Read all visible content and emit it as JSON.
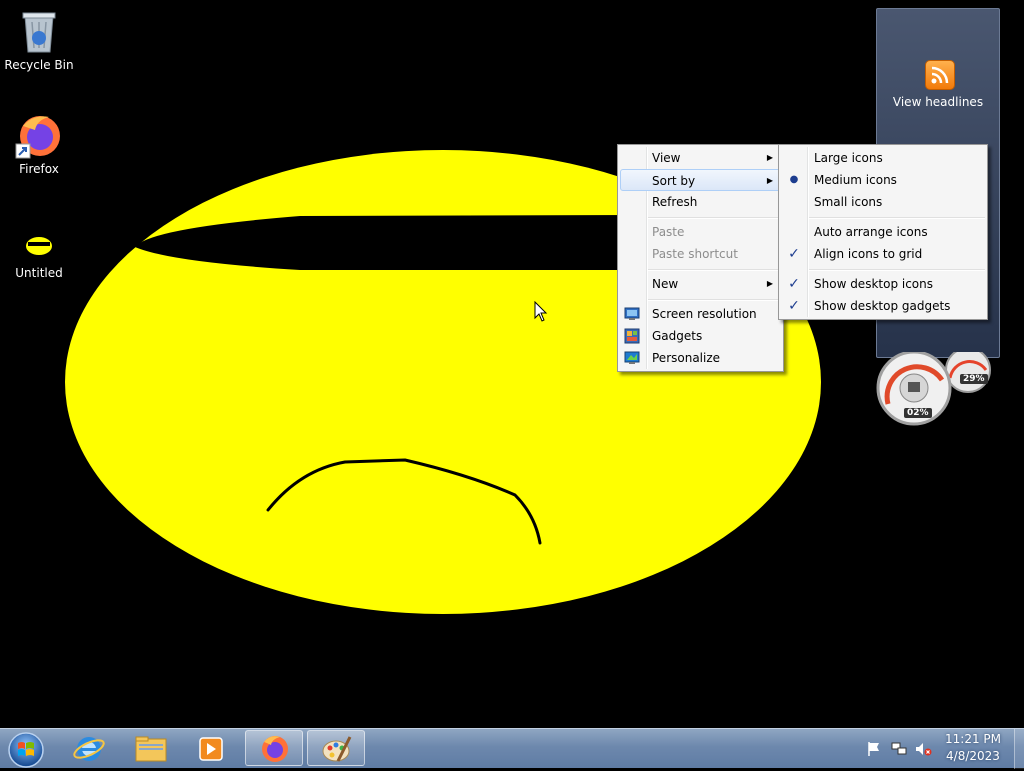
{
  "desktop": {
    "icons": [
      {
        "label": "Recycle Bin",
        "icon": "recycle-bin-icon"
      },
      {
        "label": "Firefox",
        "icon": "firefox-icon"
      },
      {
        "label": "Untitled",
        "icon": "paint-file-icon"
      }
    ]
  },
  "gadgets": {
    "feed": {
      "label": "View headlines",
      "icon": "rss-feed-icon"
    },
    "meter": {
      "cpu_percent": "02%",
      "memory_percent": "29%"
    }
  },
  "context_menu": {
    "items": [
      {
        "label": "View",
        "submenu": true,
        "enabled": true
      },
      {
        "label": "Sort by",
        "submenu": true,
        "enabled": true,
        "highlighted": true
      },
      {
        "label": "Refresh",
        "enabled": true
      },
      {
        "label": "Paste",
        "enabled": false
      },
      {
        "label": "Paste shortcut",
        "enabled": false
      },
      {
        "label": "New",
        "submenu": true,
        "enabled": true
      },
      {
        "label": "Screen resolution",
        "enabled": true,
        "icon": "screen-resolution-icon"
      },
      {
        "label": "Gadgets",
        "enabled": true,
        "icon": "gadgets-icon"
      },
      {
        "label": "Personalize",
        "enabled": true,
        "icon": "personalize-icon"
      }
    ]
  },
  "view_submenu": {
    "items": [
      {
        "label": "Large icons",
        "mark": ""
      },
      {
        "label": "Medium icons",
        "mark": "radio"
      },
      {
        "label": "Small icons",
        "mark": ""
      },
      {
        "label": "Auto arrange icons",
        "mark": ""
      },
      {
        "label": "Align icons to grid",
        "mark": "check"
      },
      {
        "label": "Show desktop icons",
        "mark": "check"
      },
      {
        "label": "Show desktop gadgets",
        "mark": "check"
      }
    ]
  },
  "taskbar": {
    "pinned": [
      {
        "name": "internet-explorer-icon",
        "open": false
      },
      {
        "name": "windows-explorer-icon",
        "open": false
      },
      {
        "name": "media-player-icon",
        "open": false
      },
      {
        "name": "firefox-icon",
        "open": true
      },
      {
        "name": "paint-icon",
        "open": true
      }
    ],
    "clock": {
      "time": "11:21 PM",
      "date": "4/8/2023"
    }
  },
  "colors": {
    "face": "#ffff00",
    "wallpaper": "#000000",
    "menu_highlight": "#dbe7f8"
  }
}
